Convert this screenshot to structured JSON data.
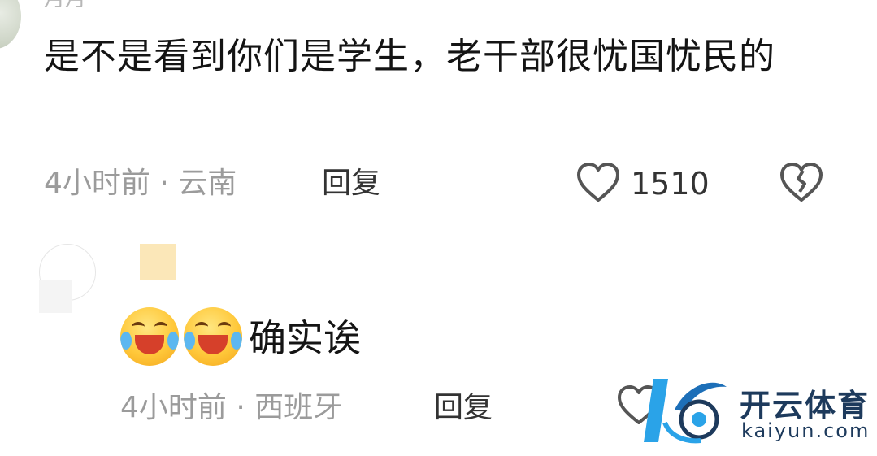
{
  "top_comment": {
    "username_partial": "月月",
    "text": "是不是看到你们是学生，老干部很忧国忧民的",
    "meta": "4小时前 · 云南",
    "reply_label": "回复",
    "like_count": "1510"
  },
  "reply_comment": {
    "emoji": [
      "face-with-tears-of-joy",
      "face-with-tears-of-joy"
    ],
    "text": "确实诶",
    "meta": "4小时前 · 西班牙",
    "reply_label": "回复"
  },
  "watermark": {
    "brand": "开云体育",
    "url": "kaiyun.com"
  },
  "colors": {
    "text_primary": "#141414",
    "text_meta": "#9b9b9b",
    "icon_gray": "#555555",
    "watermark_blue": "#1d3a5c",
    "watermark_accent": "#2aa3e8"
  }
}
